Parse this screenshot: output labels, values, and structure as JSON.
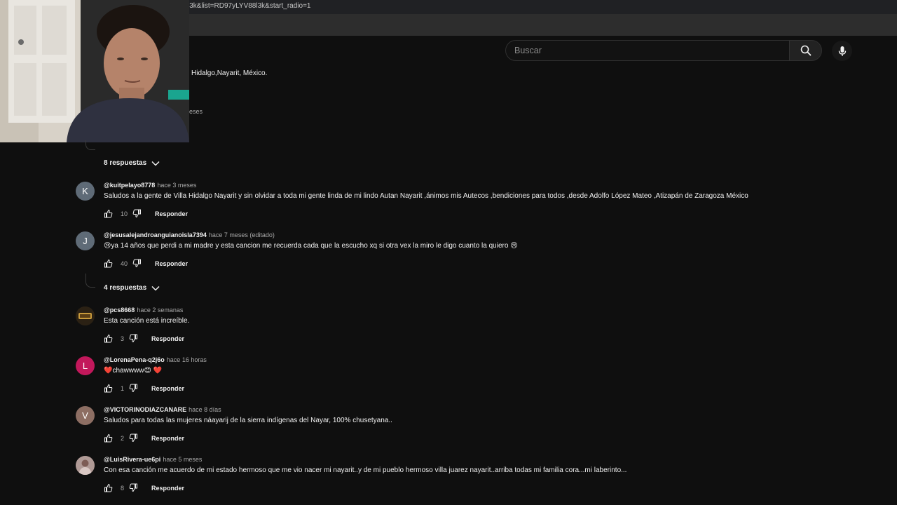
{
  "browser": {
    "url_fragment": "l3k&list=RD97yLYV88l3k&start_radio=1"
  },
  "search": {
    "placeholder": "Buscar"
  },
  "partial": {
    "location": "Hidalgo,Nayarit, México.",
    "time_tail": "eses"
  },
  "threads": [
    {
      "replies_label": "8 respuestas"
    },
    {
      "replies_label": "4 respuestas"
    }
  ],
  "comments": [
    {
      "avatar_letter": "K",
      "avatar_color": "#5f6b77",
      "handle": "@kuitpelayo8778",
      "time": "hace 3 meses",
      "text": "Saludos a la gente de Villa Hidalgo Nayarit y sin olvidar a toda mi gente linda de mi lindo Autan Nayarit ,ánimos mis Autecos ,bendiciones para todos ,desde Adolfo López Mateo ,Atizapán de Zaragoza México",
      "likes": "10",
      "reply_label": "Responder"
    },
    {
      "avatar_letter": "J",
      "avatar_color": "#5f6b77",
      "handle": "@jesusalejandroanguianoisla7394",
      "time": "hace 7 meses (editado)",
      "text": "😢ya 14 años que perdi a mi madre y esta cancion me recuerda cada que la escucho xq si otra vex la miro le digo cuanto la quiero 😢",
      "likes": "40",
      "reply_label": "Responder"
    },
    {
      "avatar_letter": "",
      "avatar_color": "#3b2e1a",
      "handle": "@pcs8668",
      "time": "hace 2 semanas",
      "text": "Esta canción está increíble.",
      "likes": "3",
      "reply_label": "Responder"
    },
    {
      "avatar_letter": "L",
      "avatar_color": "#c2185b",
      "handle": "@LorenaPena-q2j6o",
      "time": "hace 16 horas",
      "text": "❤️chawwww😊 ❤️",
      "likes": "1",
      "reply_label": "Responder"
    },
    {
      "avatar_letter": "V",
      "avatar_color": "#8d6e63",
      "handle": "@VICTORINODIAZCANARE",
      "time": "hace 8 días",
      "text": "Saludos para todas las mujeres náayarij de la sierra indígenas del Nayar, 100% chusetyana..",
      "likes": "2",
      "reply_label": "Responder"
    },
    {
      "avatar_letter": "",
      "avatar_color": "#a58a86",
      "handle": "@LuisRivera-ue6pi",
      "time": "hace 5 meses",
      "text": "Con esa canción me acuerdo de mi estado hermoso que me vio nacer mi  nayarit..y de mi pueblo hermoso villa juarez nayarit..arriba todas mi familia cora...mi laberinto...",
      "likes": "8",
      "reply_label": "Responder"
    }
  ]
}
